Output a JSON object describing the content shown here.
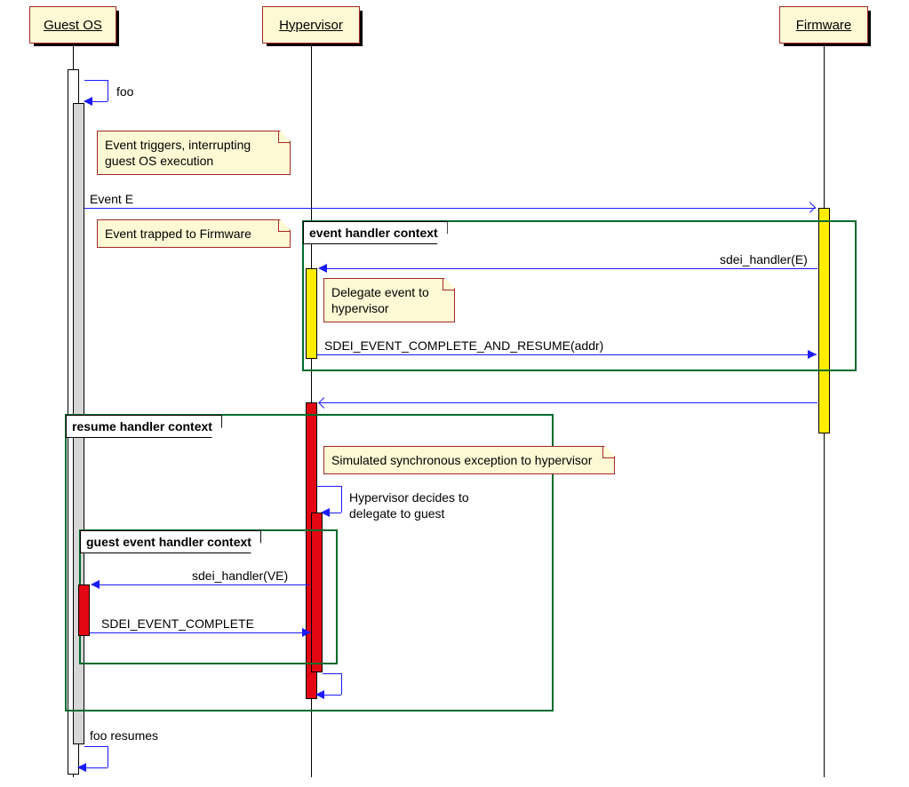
{
  "participants": {
    "guest_os": "Guest OS",
    "hypervisor": "Hypervisor",
    "firmware": "Firmware"
  },
  "messages": {
    "foo": "foo",
    "event_e": "Event E",
    "sdei_handler_e": "sdei_handler(E)",
    "complete_resume": "SDEI_EVENT_COMPLETE_AND_RESUME(addr)",
    "sdei_handler_ve": "sdei_handler(VE)",
    "event_complete": "SDEI_EVENT_COMPLETE",
    "foo_resumes": "foo resumes"
  },
  "notes": {
    "event_triggers": "Event triggers, interrupting guest OS execution",
    "trapped": "Event trapped to Firmware",
    "delegate_hyp": "Delegate event to hypervisor",
    "sim_exception": "Simulated synchronous  exception to hypervisor",
    "hyp_decides": "Hypervisor decides to delegate to guest"
  },
  "frames": {
    "event_handler": "event handler context",
    "resume_handler": "resume handler context",
    "guest_handler": "guest event handler context"
  },
  "chart_data": {
    "type": "sequence-diagram",
    "participants": [
      "Guest OS",
      "Hypervisor",
      "Firmware"
    ],
    "events": [
      {
        "type": "self-message",
        "on": "Guest OS",
        "label": "foo"
      },
      {
        "type": "note",
        "near": "Guest OS",
        "text": "Event triggers, interrupting guest OS execution"
      },
      {
        "type": "message",
        "from": "Guest OS",
        "to": "Firmware",
        "label": "Event E",
        "async": true
      },
      {
        "type": "note",
        "near": "Guest OS",
        "text": "Event trapped to Firmware"
      },
      {
        "type": "activation-start",
        "on": "Firmware",
        "color": "yellow"
      },
      {
        "type": "frame-start",
        "name": "event handler context",
        "covers": [
          "Hypervisor",
          "Firmware"
        ]
      },
      {
        "type": "message",
        "from": "Firmware",
        "to": "Hypervisor",
        "label": "sdei_handler(E)"
      },
      {
        "type": "activation-start",
        "on": "Hypervisor",
        "color": "yellow"
      },
      {
        "type": "note",
        "near": "Hypervisor",
        "text": "Delegate event to hypervisor"
      },
      {
        "type": "message",
        "from": "Hypervisor",
        "to": "Firmware",
        "label": "SDEI_EVENT_COMPLETE_AND_RESUME(addr)"
      },
      {
        "type": "activation-end",
        "on": "Hypervisor"
      },
      {
        "type": "frame-end"
      },
      {
        "type": "message",
        "from": "Firmware",
        "to": "Hypervisor",
        "label": "",
        "async": true
      },
      {
        "type": "activation-start",
        "on": "Hypervisor",
        "color": "red"
      },
      {
        "type": "frame-start",
        "name": "resume handler context",
        "covers": [
          "Guest OS",
          "Hypervisor"
        ]
      },
      {
        "type": "note",
        "near": "Hypervisor",
        "text": "Simulated synchronous  exception to hypervisor"
      },
      {
        "type": "note",
        "near": "Hypervisor",
        "text": "Hypervisor decides to delegate to guest"
      },
      {
        "type": "frame-start",
        "name": "guest event handler context",
        "covers": [
          "Guest OS",
          "Hypervisor"
        ]
      },
      {
        "type": "message",
        "from": "Hypervisor",
        "to": "Guest OS",
        "label": "sdei_handler(VE)"
      },
      {
        "type": "activation-start",
        "on": "Guest OS",
        "color": "red"
      },
      {
        "type": "message",
        "from": "Guest OS",
        "to": "Hypervisor",
        "label": "SDEI_EVENT_COMPLETE"
      },
      {
        "type": "activation-end",
        "on": "Guest OS"
      },
      {
        "type": "frame-end"
      },
      {
        "type": "self-message",
        "on": "Hypervisor",
        "label": ""
      },
      {
        "type": "activation-end",
        "on": "Hypervisor"
      },
      {
        "type": "frame-end"
      },
      {
        "type": "activation-end",
        "on": "Firmware"
      },
      {
        "type": "self-message",
        "on": "Guest OS",
        "label": "foo resumes"
      }
    ]
  }
}
